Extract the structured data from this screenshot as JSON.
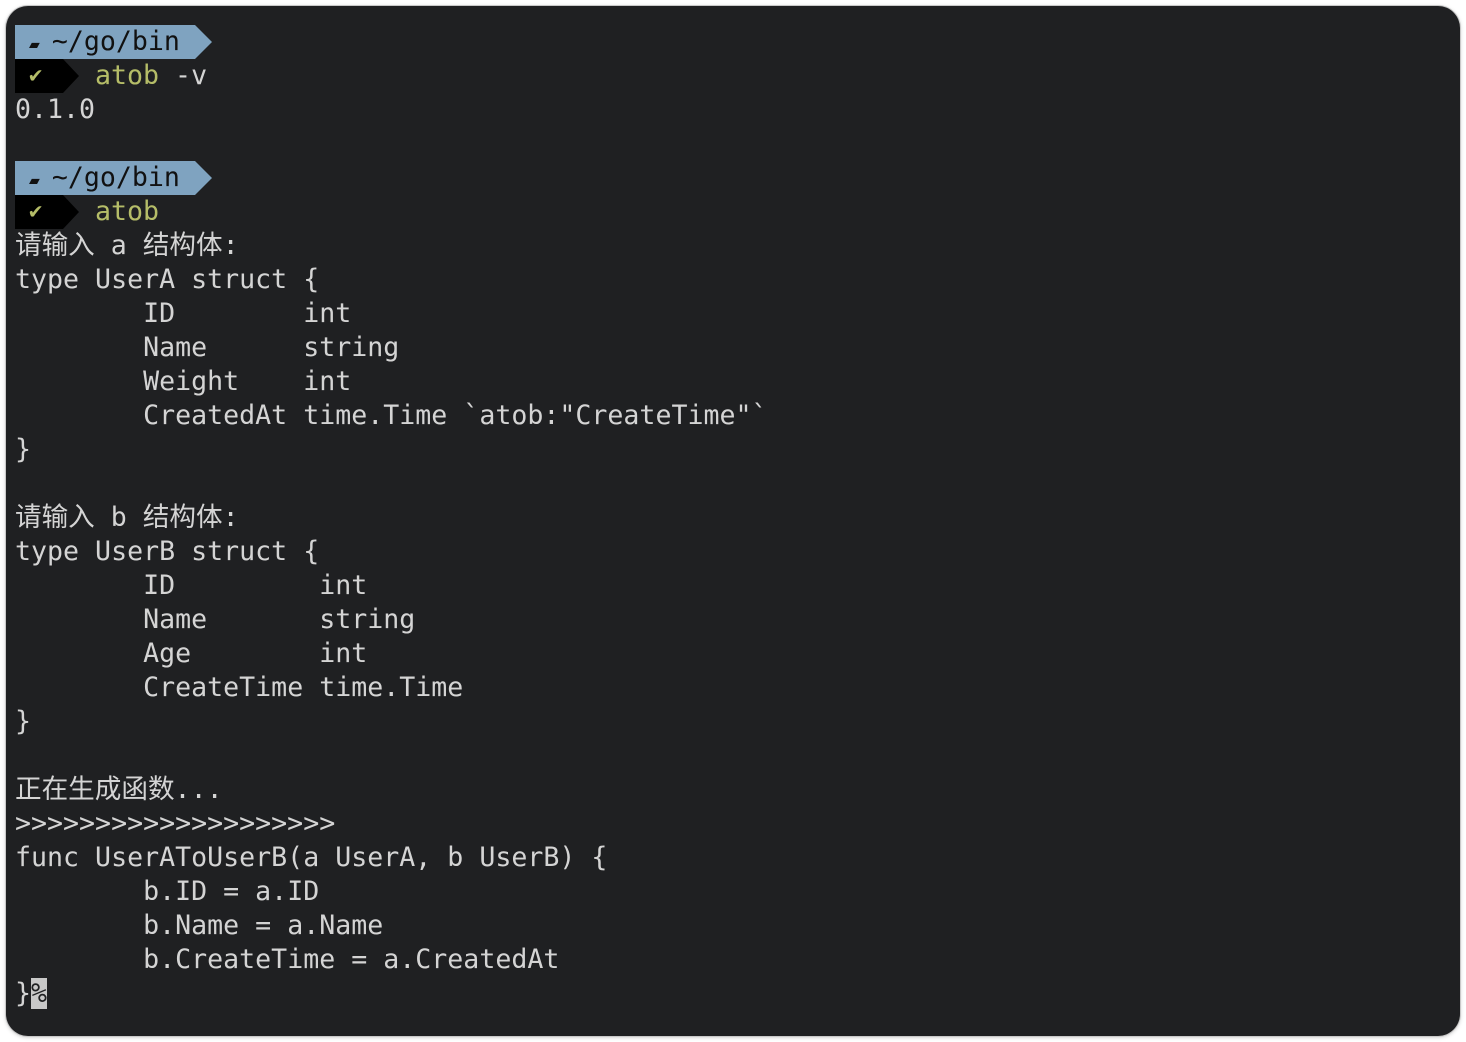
{
  "prompt": {
    "dir": "~/go/bin",
    "folder_icon": "folder-open-icon",
    "status_icon": "check-icon",
    "colors": {
      "dir_bg": "#7fa3c0",
      "command": "#b5bd68",
      "background": "#1f2022"
    }
  },
  "lines": [
    {
      "kind": "prompt-dir"
    },
    {
      "kind": "prompt-cmd",
      "cmd": "atob",
      "args": " -v"
    },
    {
      "kind": "text",
      "text": "0.1.0"
    },
    {
      "kind": "text",
      "text": ""
    },
    {
      "kind": "prompt-dir"
    },
    {
      "kind": "prompt-cmd",
      "cmd": "atob",
      "args": ""
    },
    {
      "kind": "text",
      "text": "请输入 a 结构体:"
    },
    {
      "kind": "text",
      "text": "type UserA struct {"
    },
    {
      "kind": "text",
      "text": "\tID        int"
    },
    {
      "kind": "text",
      "text": "\tName      string"
    },
    {
      "kind": "text",
      "text": "\tWeight    int"
    },
    {
      "kind": "text",
      "text": "\tCreatedAt time.Time `atob:\"CreateTime\"`"
    },
    {
      "kind": "text",
      "text": "}"
    },
    {
      "kind": "text",
      "text": ""
    },
    {
      "kind": "text",
      "text": "请输入 b 结构体:"
    },
    {
      "kind": "text",
      "text": "type UserB struct {"
    },
    {
      "kind": "text",
      "text": "\tID         int"
    },
    {
      "kind": "text",
      "text": "\tName       string"
    },
    {
      "kind": "text",
      "text": "\tAge        int"
    },
    {
      "kind": "text",
      "text": "\tCreateTime time.Time"
    },
    {
      "kind": "text",
      "text": "}"
    },
    {
      "kind": "text",
      "text": ""
    },
    {
      "kind": "text",
      "text": "正在生成函数..."
    },
    {
      "kind": "text",
      "text": ">>>>>>>>>>>>>>>>>>>>"
    },
    {
      "kind": "text",
      "text": "func UserAToUserB(a UserA, b UserB) {"
    },
    {
      "kind": "text",
      "text": "\tb.ID = a.ID"
    },
    {
      "kind": "text",
      "text": "\tb.Name = a.Name"
    },
    {
      "kind": "text",
      "text": "\tb.CreateTime = a.CreatedAt"
    },
    {
      "kind": "last",
      "text": "}",
      "cursor": "%"
    }
  ]
}
